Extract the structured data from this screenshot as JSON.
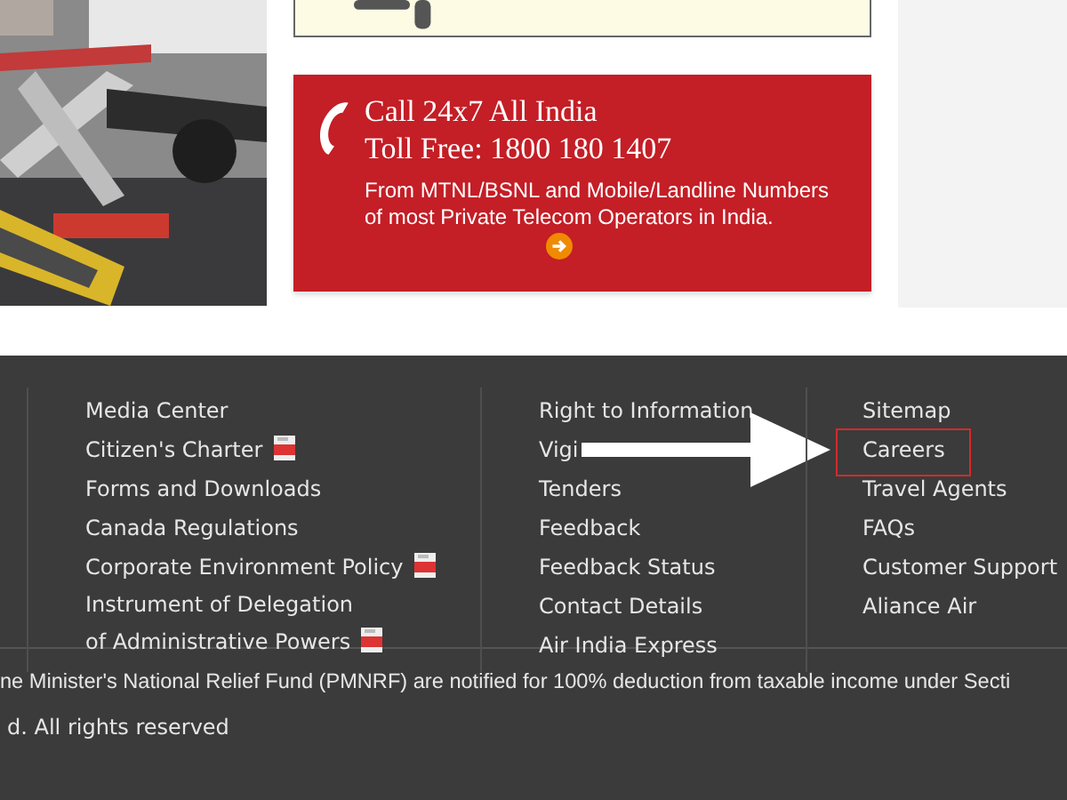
{
  "helpline": {
    "title": "Call 24x7 All India",
    "toll_free": "Toll Free: 1800 180 1407",
    "description": "From MTNL/BSNL and Mobile/Landline Numbers of most Private Telecom Operators in India."
  },
  "footer": {
    "columns": [
      {
        "links": [
          {
            "label": "Media Center",
            "pdf": false
          },
          {
            "label": "Citizen's Charter",
            "pdf": true
          },
          {
            "label": "Forms and Downloads",
            "pdf": false
          },
          {
            "label": "Canada Regulations",
            "pdf": false
          },
          {
            "label": "Corporate Environment Policy",
            "pdf": true
          },
          {
            "label": "Instrument of Delegation of Administrative Powers",
            "pdf": true
          }
        ]
      },
      {
        "links": [
          {
            "label": "Right to Information",
            "pdf": false
          },
          {
            "label": "Vigi",
            "pdf": false
          },
          {
            "label": "Tenders",
            "pdf": false
          },
          {
            "label": "Feedback",
            "pdf": false
          },
          {
            "label": "Feedback Status",
            "pdf": false
          },
          {
            "label": "Contact Details",
            "pdf": false
          },
          {
            "label": "Air India Express",
            "pdf": false
          }
        ]
      },
      {
        "links": [
          {
            "label": "Sitemap",
            "highlighted": false
          },
          {
            "label": "Careers",
            "highlighted": true
          },
          {
            "label": "Travel Agents",
            "highlighted": false
          },
          {
            "label": "FAQs",
            "highlighted": false
          },
          {
            "label": "Customer Support",
            "highlighted": false
          },
          {
            "label": "Aliance Air",
            "highlighted": false
          }
        ]
      }
    ],
    "notice": "ne Minister's National Relief Fund (PMNRF) are notified for 100% deduction from taxable income under Secti",
    "copyright": "d. All rights reserved"
  }
}
